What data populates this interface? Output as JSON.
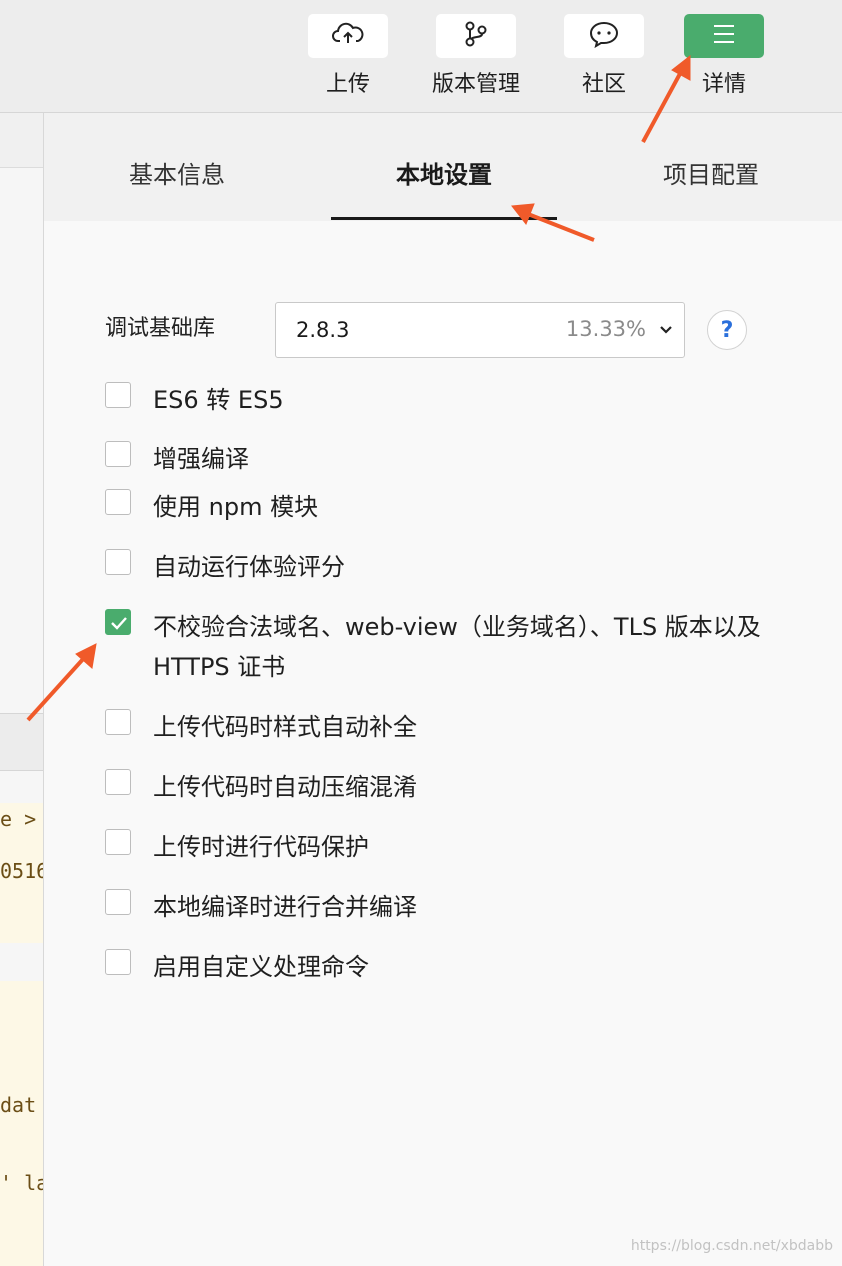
{
  "toolbar": {
    "buttons": [
      {
        "label": "上传",
        "icon": "cloud-upload-icon"
      },
      {
        "label": "版本管理",
        "icon": "branch-icon"
      },
      {
        "label": "社区",
        "icon": "chat-bubble-icon"
      },
      {
        "label": "详情",
        "icon": "menu-icon"
      }
    ]
  },
  "tabs": [
    "基本信息",
    "本地设置",
    "项目配置"
  ],
  "debug_lib": {
    "label": "调试基础库",
    "version": "2.8.3",
    "percent": "13.33%",
    "help": "?"
  },
  "options": [
    {
      "label": "ES6 转 ES5",
      "checked": false
    },
    {
      "label": "增强编译",
      "checked": false
    },
    {
      "label": "使用 npm 模块",
      "checked": false
    },
    {
      "label": "自动运行体验评分",
      "checked": false
    },
    {
      "label": "不校验合法域名、web-view（业务域名）、TLS 版本以及 HTTPS 证书",
      "checked": true
    },
    {
      "label": "上传代码时样式自动补全",
      "checked": false
    },
    {
      "label": "上传代码时自动压缩混淆",
      "checked": false
    },
    {
      "label": "上传时进行代码保护",
      "checked": false
    },
    {
      "label": "本地编译时进行合并编译",
      "checked": false
    },
    {
      "label": "启用自定义处理命令",
      "checked": false
    }
  ],
  "left_code": [
    "e >",
    "0516",
    "dat",
    "' la"
  ],
  "watermark": "https://blog.csdn.net/xbdabb",
  "colors": {
    "accent": "#4aac6d",
    "annotation_arrow": "#f05a2a",
    "help": "#2a6fdb"
  }
}
